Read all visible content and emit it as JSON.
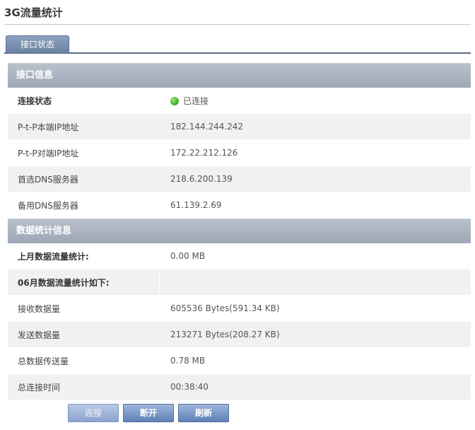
{
  "page_title": "3G流量统计",
  "tab": {
    "label": "接口状态"
  },
  "interface": {
    "section_title": "接口信息",
    "status_label": "连接状态",
    "status_value": "已连接",
    "ptp_local_ip_label": "P-t-P本端IP地址",
    "ptp_local_ip_value": "182.144.244.242",
    "ptp_remote_ip_label": "P-t-P对端IP地址",
    "ptp_remote_ip_value": "172.22.212.126",
    "primary_dns_label": "首选DNS服务器",
    "primary_dns_value": "218.6.200.139",
    "secondary_dns_label": "备用DNS服务器",
    "secondary_dns_value": "61.139.2.69"
  },
  "stats": {
    "section_title": "数据统计信息",
    "last_month_label": "上月数据流量统计:",
    "last_month_value": "0.00 MB",
    "current_month_label": "06月数据流量统计如下:",
    "received_label": "接收数据量",
    "received_value": "605536 Bytes(591.34 KB)",
    "sent_label": "发送数据量",
    "sent_value": "213271 Bytes(208.27 KB)",
    "total_label": "总数据传送量",
    "total_value": "0.78 MB",
    "time_label": "总连接时间",
    "time_value": "00:38:40"
  },
  "buttons": {
    "connect": "连接",
    "disconnect": "断开",
    "refresh": "刷新"
  },
  "colors": {
    "section_bg": "#a9b2bf",
    "tab_bg": "#7d91b2",
    "button_bg": "#6f8ec2",
    "status_dot": "#46b02e"
  }
}
